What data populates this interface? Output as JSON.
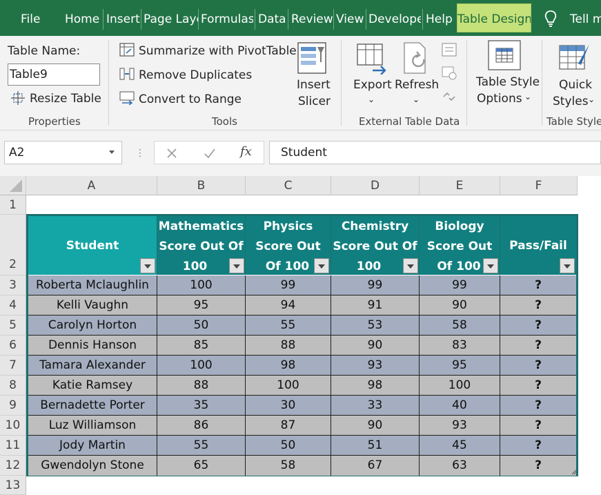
{
  "ribbon_tabs": [
    "File",
    "Home",
    "Insert",
    "Page Layc",
    "Formulas",
    "Data",
    "Review",
    "View",
    "Develope",
    "Help",
    "Table Design",
    "Tell m"
  ],
  "active_tab": "Table Design",
  "colors": {
    "ribbon_green": "#217346",
    "active_tab_bg": "#c5e17a",
    "table_border": "#1d6f6f",
    "header_first": "#14a6a6",
    "header_dark": "#117f7f",
    "band_odd": "#a4aec0",
    "band_even": "#bebebe"
  },
  "properties": {
    "table_name_label": "Table Name:",
    "table_name_value": "Table9",
    "resize_label": "Resize Table",
    "group_label": "Properties"
  },
  "tools": {
    "summarize_label": "Summarize with PivotTable",
    "remove_duplicates_label": "Remove Duplicates",
    "convert_label": "Convert to Range",
    "insert_label": "Insert",
    "slicer_label": "Slicer",
    "group_label": "Tools"
  },
  "external": {
    "export_label": "Export",
    "refresh_label": "Refresh",
    "group_label": "External Table Data"
  },
  "style_options": {
    "label_line1": "Table Style",
    "label_line2": "Options"
  },
  "styles": {
    "label_line1": "Quick",
    "label_line2": "Styles",
    "group_label": "Table Styles"
  },
  "formula_bar": {
    "cell_ref": "A2",
    "fx_label": "fx",
    "content": "Student"
  },
  "columns": [
    "A",
    "B",
    "C",
    "D",
    "E",
    "F"
  ],
  "row_numbers": [
    "1",
    "2",
    "3",
    "4",
    "5",
    "6",
    "7",
    "8",
    "9",
    "10",
    "11",
    "12",
    "13"
  ],
  "table": {
    "headers": [
      [
        "Student"
      ],
      [
        "Mathematics",
        "Score Out Of",
        "100"
      ],
      [
        "Physics",
        "Score Out",
        "Of 100"
      ],
      [
        "Chemistry",
        "Score Out Of",
        "100"
      ],
      [
        "Biology",
        "Score Out",
        "Of 100"
      ],
      [
        "Pass/Fail"
      ]
    ],
    "rows": [
      [
        "Roberta Mclaughlin",
        "100",
        "99",
        "99",
        "99",
        "?"
      ],
      [
        "Kelli Vaughn",
        "95",
        "94",
        "91",
        "90",
        "?"
      ],
      [
        "Carolyn Horton",
        "50",
        "55",
        "53",
        "58",
        "?"
      ],
      [
        "Dennis Hanson",
        "85",
        "88",
        "90",
        "83",
        "?"
      ],
      [
        "Tamara Alexander",
        "100",
        "98",
        "93",
        "95",
        "?"
      ],
      [
        "Katie Ramsey",
        "88",
        "100",
        "98",
        "100",
        "?"
      ],
      [
        "Bernadette Porter",
        "35",
        "30",
        "33",
        "40",
        "?"
      ],
      [
        "Luz Williamson",
        "86",
        "87",
        "90",
        "93",
        "?"
      ],
      [
        "Jody Martin",
        "55",
        "50",
        "51",
        "45",
        "?"
      ],
      [
        "Gwendolyn Stone",
        "65",
        "58",
        "67",
        "63",
        "?"
      ]
    ]
  }
}
